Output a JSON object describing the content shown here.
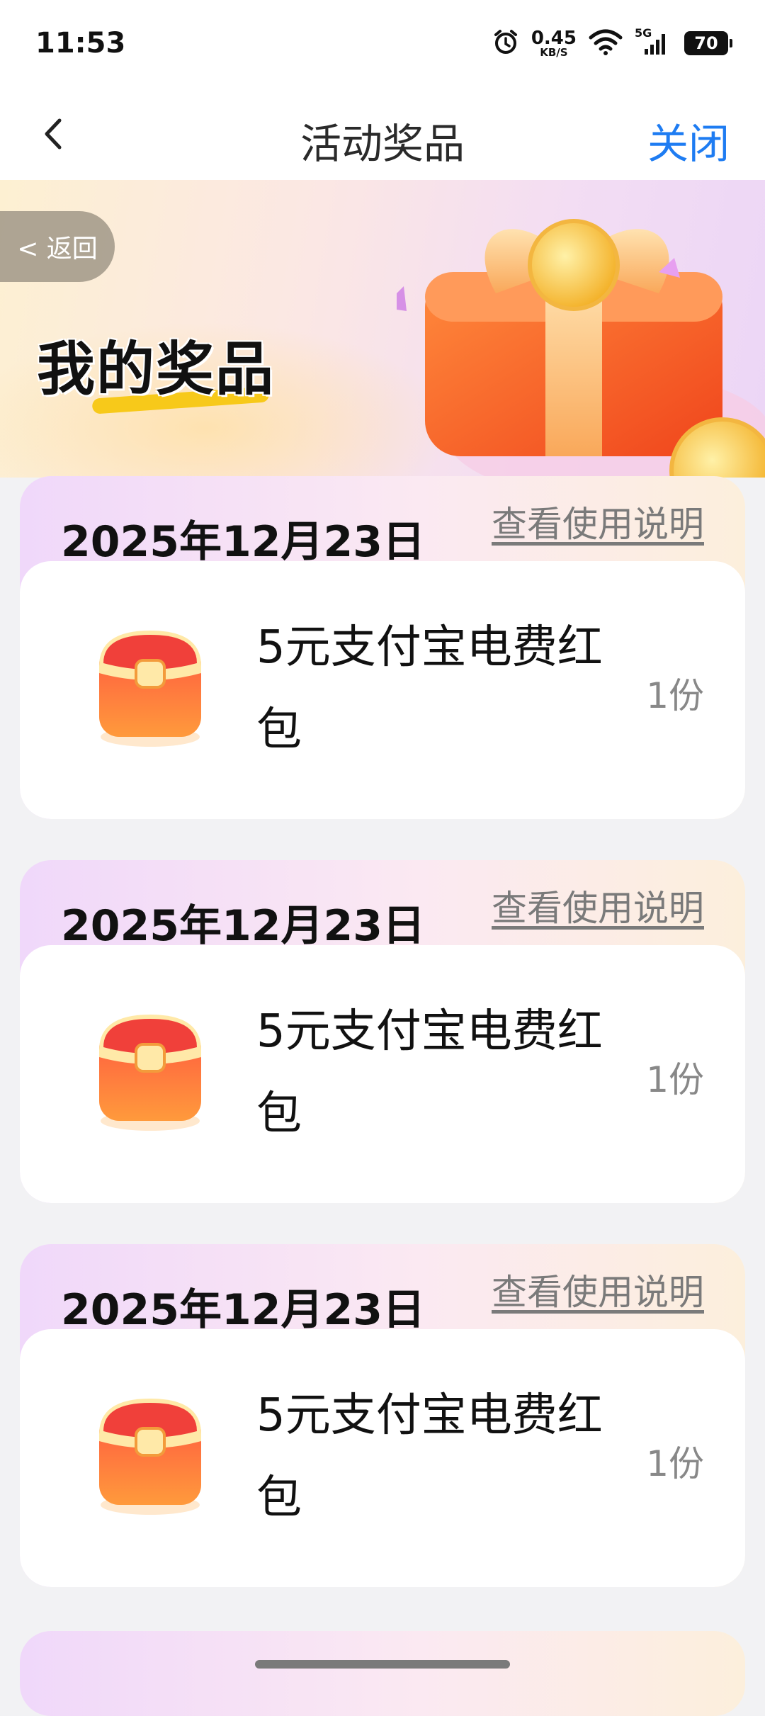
{
  "status_bar": {
    "time": "11:53",
    "net_speed_value": "0.45",
    "net_speed_unit": "KB/S",
    "signal_label": "5G",
    "battery": "70"
  },
  "nav": {
    "title": "活动奖品",
    "close_label": "关闭",
    "accent_color": "#1e7cf2"
  },
  "banner": {
    "return_label": "< 返回",
    "title": "我的奖品"
  },
  "prizes": [
    {
      "date": "2025年12月23日",
      "link": "查看使用说明",
      "name": "5元支付宝电费红包",
      "qty": "1份"
    },
    {
      "date": "2025年12月23日",
      "link": "查看使用说明",
      "name": "5元支付宝电费红包",
      "qty": "1份"
    },
    {
      "date": "2025年12月23日",
      "link": "查看使用说明",
      "name": "5元支付宝电费红包",
      "qty": "1份"
    }
  ]
}
